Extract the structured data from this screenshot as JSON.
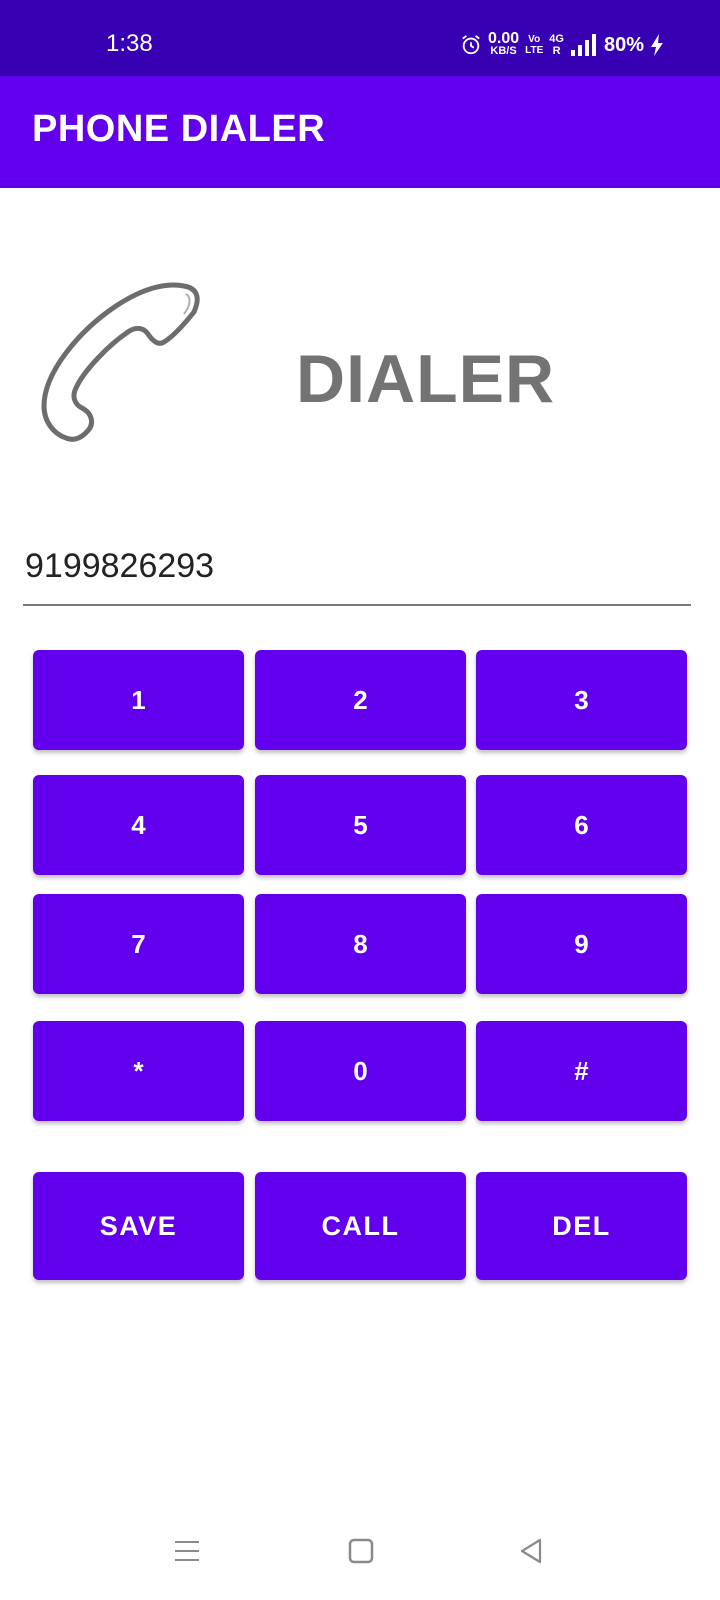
{
  "status_bar": {
    "time": "1:38",
    "net_speed_value": "0.00",
    "net_speed_unit": "KB/S",
    "volte_top": "Vo",
    "volte_bottom": "LTE",
    "network_type": "4G",
    "roaming": "R",
    "battery": "80%",
    "icons": [
      "alarm-icon",
      "signal-icon",
      "charging-bolt-icon"
    ]
  },
  "app_bar": {
    "title": "PHONE DIALER"
  },
  "header": {
    "label": "DIALER",
    "icon": "phone-handset-icon"
  },
  "dial_input": {
    "value": "9199826293"
  },
  "keypad": {
    "keys": [
      "1",
      "2",
      "3",
      "4",
      "5",
      "6",
      "7",
      "8",
      "9",
      "*",
      "0",
      "#"
    ]
  },
  "actions": {
    "save": "SAVE",
    "call": "CALL",
    "del": "DEL"
  },
  "nav_bar": {
    "icons": [
      "menu-icon",
      "home-icon",
      "back-icon"
    ]
  },
  "colors": {
    "status_bar": "#3700b3",
    "primary": "#6200ee",
    "label_gray": "#737373"
  }
}
